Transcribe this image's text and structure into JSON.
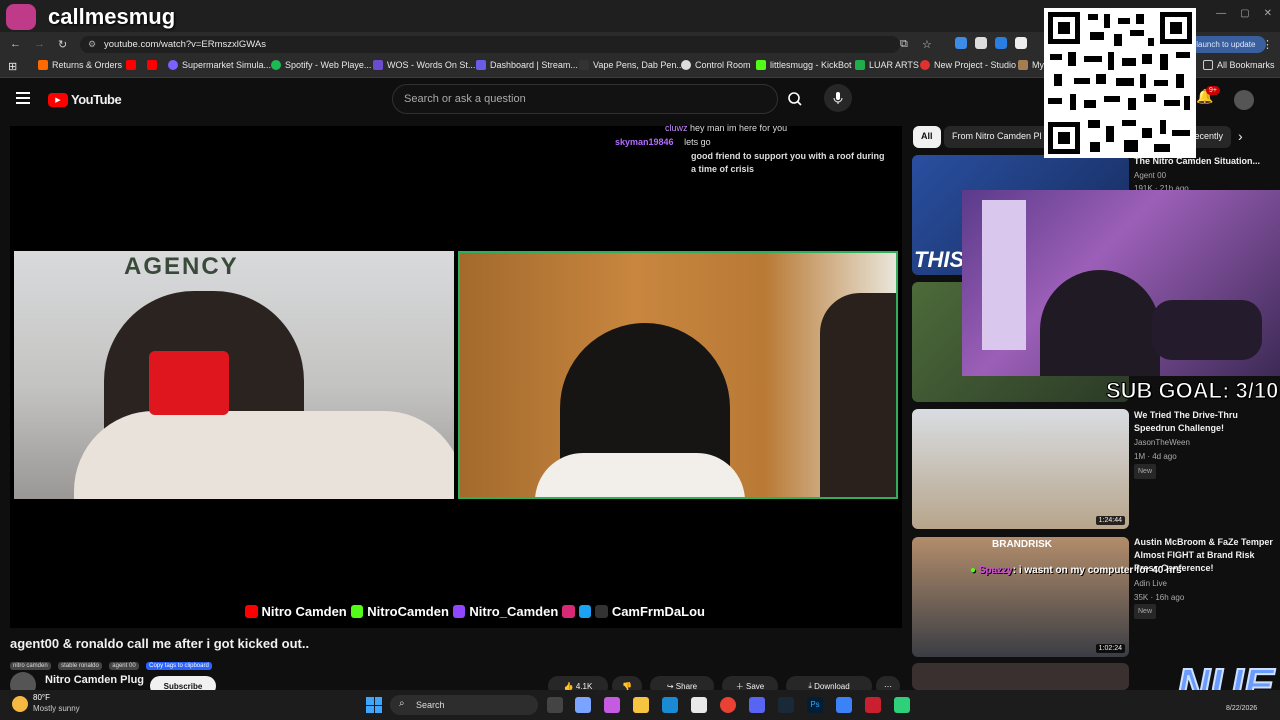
{
  "overlay": {
    "streamer_name": "callmesmug",
    "sub_goal": "SUB GOAL: 3/10",
    "chat_user": "Spazzy",
    "chat_message": "i wasnt on my computer for 40 hrs",
    "logo_text": "NUE"
  },
  "browser": {
    "url": "youtube.com/watch?v=ERmszxlGWAs",
    "relaunch": "Relaunch to update",
    "all_bookmarks": "All Bookmarks",
    "bookmarks": [
      "Returns & Orders",
      "Supermarket Simula...",
      "Spotify - Web Playe...",
      "WOS - Words On St...",
      "Dashboard | Stream...",
      "Vape Pens, Dab Pen...",
      "Control Room",
      "littlesmugg - KickBot",
      "LUAR ARTS",
      "New Project - Studio",
      "My"
    ]
  },
  "youtube": {
    "logo": "YouTube",
    "search_placeholder": "Search or ask a question",
    "notif_count": "9+"
  },
  "video": {
    "title": "agent00 & ronaldo call me after i got kicked out..",
    "tags": [
      "nitro camden",
      "stable ronaldo",
      "agent 00"
    ],
    "copy_tags": "Copy tags to clipboard",
    "channel": "Nitro Camden Plug",
    "subscribe": "Subscribe",
    "likes": "4.1K",
    "share": "Share",
    "save": "Save",
    "download": "Download",
    "social_text": [
      "Nitro Camden",
      "NitroCamden",
      "Nitro_Camden",
      "CamFrmDaLou"
    ],
    "agency_sign": "AGENCY"
  },
  "stream_chat": [
    {
      "user": "cluwz",
      "msg": "hey man im here for you"
    },
    {
      "user": "skyman19846",
      "msg": "lets go"
    },
    {
      "user": "",
      "msg": "good friend to support you with a roof during a time of crisis"
    }
  ],
  "sidebar": {
    "chips": [
      "All",
      "From Nitro Camden Pl",
      "Recently"
    ],
    "videos": [
      {
        "title": "The Nitro Camden Situation...",
        "channel": "Agent 00",
        "meta": "191K · 21h ago",
        "thumb_text": "THIS"
      },
      {
        "title": "We Tried The Drive-Thru Speedrun Challenge!",
        "channel": "JasonTheWeen",
        "meta": "1M · 4d ago",
        "badge": "New",
        "duration": "1:24:44"
      },
      {
        "title": "Austin McBroom & FaZe Temper Almost FIGHT at Brand Risk Press Conference!",
        "channel": "Adin Live",
        "meta": "35K · 16h ago",
        "badge": "New",
        "duration": "1:02:24",
        "thumb_text": "BRANDRISK"
      }
    ]
  },
  "taskbar": {
    "temp": "80°F",
    "weather": "Mostly sunny",
    "search": "Search",
    "date": "8/22/2026"
  },
  "colors": {
    "yt_red": "#ff0000",
    "bg": "#0f0f0f",
    "chat_user": "#b36bff",
    "accent": "#3ea6ff"
  }
}
